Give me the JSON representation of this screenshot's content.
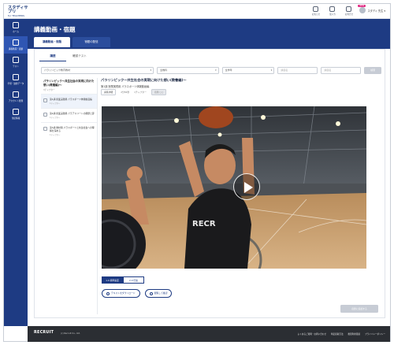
{
  "app": {
    "logo_line1": "スタディサプリ",
    "logo_line2": "for TEACHERS"
  },
  "topbar": {
    "icons": [
      {
        "name": "notification-icon",
        "label": "お知らせ"
      },
      {
        "name": "help-icon",
        "label": "使い方"
      },
      {
        "name": "contact-icon",
        "label": "お問合せ"
      }
    ],
    "new_badge": "NEW",
    "user_name": "スタディ 先生 ▾"
  },
  "sidebar": {
    "items": [
      {
        "label": "ホーム"
      },
      {
        "label": "講義動画・宿題"
      },
      {
        "label": "テスト"
      },
      {
        "label": "学習・進捗データ"
      },
      {
        "label": "アカウント管理"
      },
      {
        "label": "生徒情報"
      }
    ]
  },
  "header": {
    "title": "講義動画・宿題",
    "tabs": [
      {
        "label": "講義動画・宿題"
      },
      {
        "label": "宿題の配信"
      }
    ]
  },
  "subtabs": [
    {
      "label": "講座"
    },
    {
      "label": "確認テスト"
    }
  ],
  "filters": {
    "course": "パラリンピック教育教材",
    "grade": "全教科",
    "subject": "全学年",
    "keyword_placeholder": "講座名",
    "keyword2_placeholder": "講座名",
    "search_label": "検索"
  },
  "list": {
    "header": "パラリンピック～共生社会の実現に向けた想い(教養編)～",
    "meta": "3チャプター",
    "items": [
      {
        "text": "第1講 授業実践用 パラスポーツ体験動画編",
        "sub": "1チャプター",
        "selected": true
      },
      {
        "text": "第2講 授業実践用 パラアスリートの経歴と夢",
        "sub": "1チャプター",
        "selected": false
      },
      {
        "text": "第3講 教材用 パラスポーツと共生社会への理解を深める",
        "sub": "1チャプター",
        "selected": false
      }
    ]
  },
  "detail": {
    "title": "パラリンピック～共生社会の実現に向けた想い(教養編)～",
    "subtitle": "第1講 授業実践用 パラスポーツ体験動画編",
    "meta_label": "講座詳細",
    "meta_time": "2分56秒",
    "meta_chapter": "1チャプター",
    "meta_tag": "宿題 ○○"
  },
  "video": {
    "play_label": "再生"
  },
  "speed": {
    "normal": "1.0 標準速度",
    "fast": "2.0 倍速"
  },
  "actions": {
    "download": "テキストをダウンロード",
    "preview": "閲覧して確認"
  },
  "report_button": "宿題に追加する",
  "footer": {
    "logo": "RECRUIT",
    "copyright": "(c) Recruit Co., Ltd.",
    "links": [
      "よくあるご質問・お問い合わせ",
      "特定商取引法",
      "推奨利用環境",
      "プライバシーポリシー"
    ]
  },
  "colors": {
    "brand": "#1e3b83",
    "accent": "#e0257f",
    "footer": "#2b2e33"
  }
}
